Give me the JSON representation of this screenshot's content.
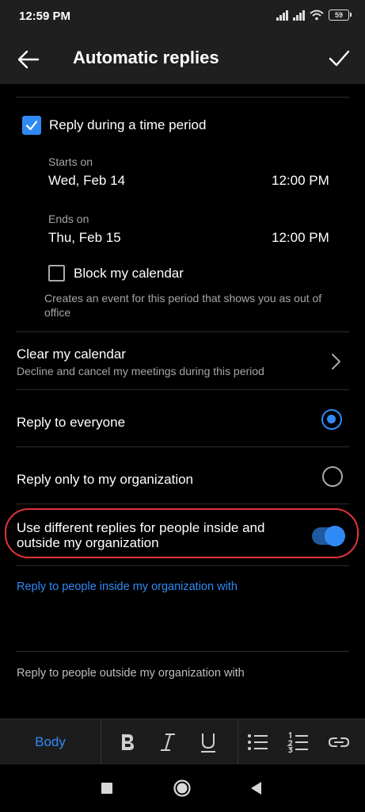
{
  "status_bar": {
    "time": "12:59 PM",
    "battery": "59"
  },
  "header": {
    "title": "Automatic replies",
    "back_icon": "arrow-left-icon",
    "confirm_icon": "checkmark-icon"
  },
  "time_period": {
    "checkbox_label": "Reply during a time period",
    "checked": true,
    "starts_label": "Starts on",
    "start_date": "Wed, Feb 14",
    "start_time": "12:00 PM",
    "ends_label": "Ends on",
    "end_date": "Thu, Feb 15",
    "end_time": "12:00 PM",
    "block_calendar_label": "Block my calendar",
    "block_calendar_checked": false,
    "block_calendar_help": "Creates an event for this period that shows you as out of office"
  },
  "clear_calendar": {
    "title": "Clear my calendar",
    "subtitle": "Decline and cancel my meetings during this period"
  },
  "audience": {
    "options": [
      {
        "label": "Reply to everyone",
        "selected": true
      },
      {
        "label": "Reply only to my organization",
        "selected": false
      }
    ]
  },
  "different_replies": {
    "label": "Use different replies for people inside and outside my organization",
    "enabled": true
  },
  "inside_reply": {
    "label": "Reply to people inside my organization with"
  },
  "outside_reply": {
    "label": "Reply to people outside my organization with"
  },
  "toolbar": {
    "body_label": "Body",
    "icons": [
      "bold-icon",
      "italic-icon",
      "underline-icon",
      "bullet-list-icon",
      "numbered-list-icon",
      "link-icon"
    ]
  },
  "colors": {
    "accent": "#2f8af5",
    "background": "#000000",
    "header": "#1f1f1f",
    "highlight_outline": "#e0333b"
  }
}
